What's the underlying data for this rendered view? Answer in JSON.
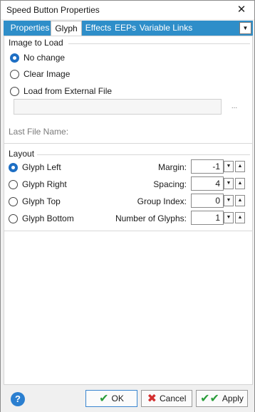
{
  "window": {
    "title": "Speed Button Properties"
  },
  "tabs": [
    {
      "label": "Properties"
    },
    {
      "label": "Glyph"
    },
    {
      "label": "Effects"
    },
    {
      "label": "EEPs"
    },
    {
      "label": "Variable Links"
    }
  ],
  "image_group": {
    "title": "Image to Load",
    "options": [
      "No change",
      "Clear Image",
      "Load from External File"
    ],
    "selected": "No change",
    "file_path": "",
    "browse_label": "...",
    "last_file_label": "Last File Name:",
    "last_file_value": ""
  },
  "layout_group": {
    "title": "Layout",
    "options": [
      "Glyph Left",
      "Glyph Right",
      "Glyph Top",
      "Glyph Bottom"
    ],
    "selected": "Glyph Left",
    "fields": [
      {
        "label": "Margin:",
        "value": "-1"
      },
      {
        "label": "Spacing:",
        "value": "4"
      },
      {
        "label": "Group Index:",
        "value": "0"
      },
      {
        "label": "Number of Glyphs:",
        "value": "1"
      }
    ]
  },
  "footer": {
    "help_label": "?",
    "ok_label": "OK",
    "cancel_label": "Cancel",
    "apply_label": "Apply"
  },
  "colors": {
    "tab_strip": "#2e8ec9",
    "accent": "#1e6fc4",
    "ok_check": "#2a9d3a",
    "cancel_x": "#d32f2f"
  }
}
